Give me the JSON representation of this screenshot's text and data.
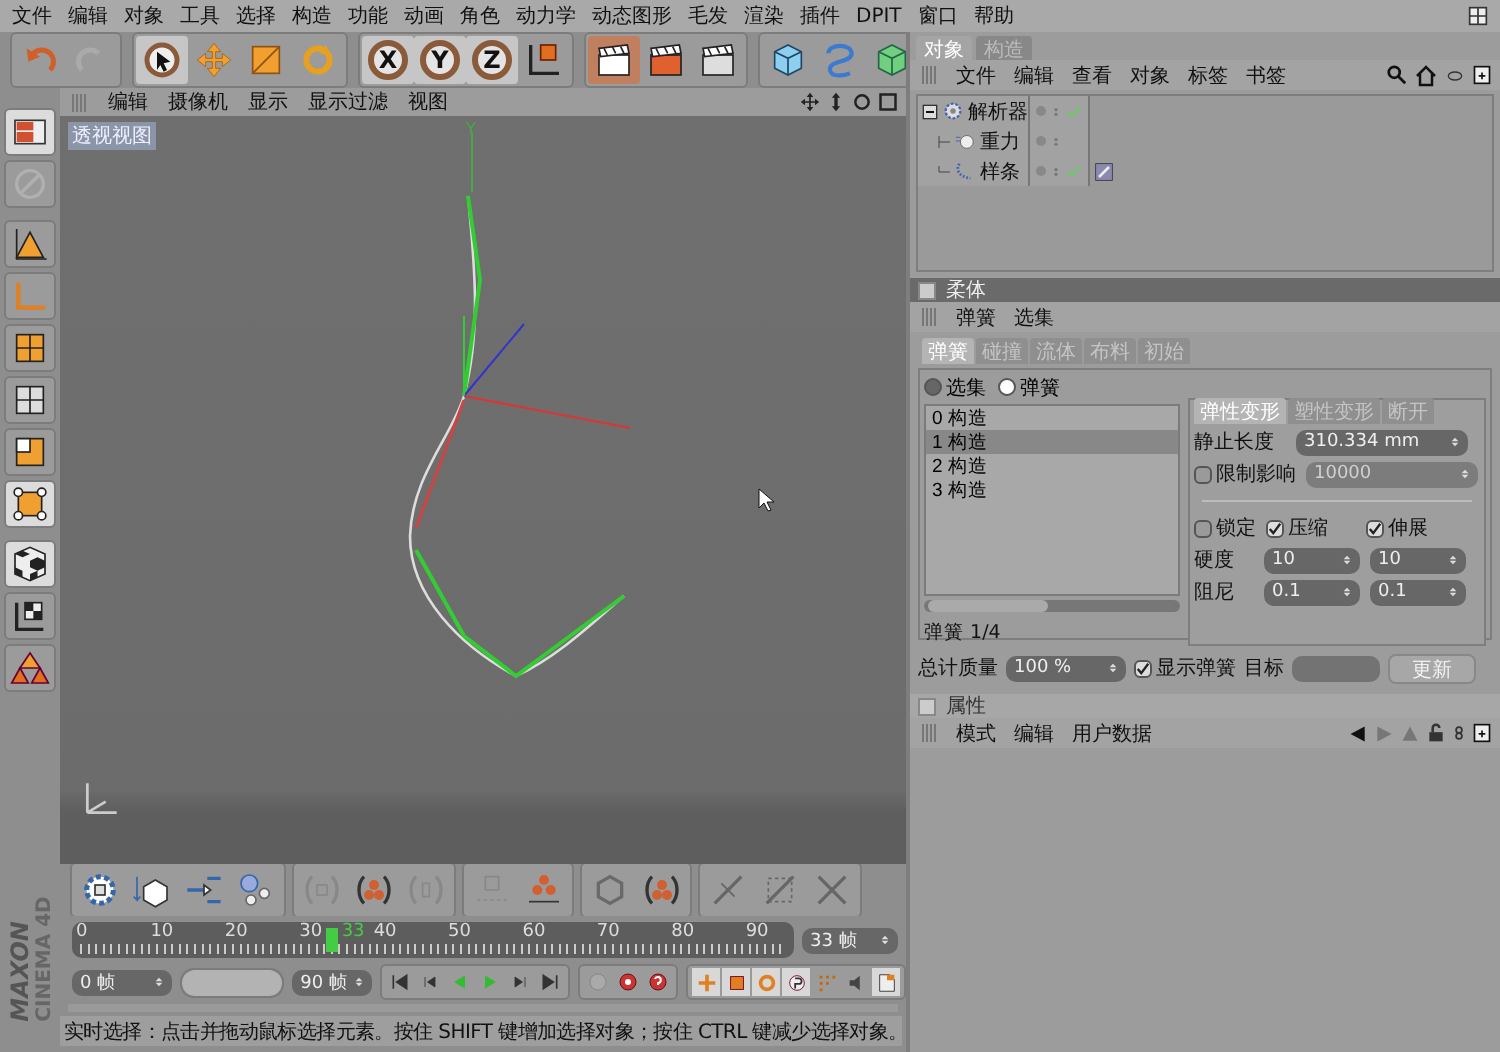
{
  "menu_bar": [
    "文件",
    "编辑",
    "对象",
    "工具",
    "选择",
    "构造",
    "功能",
    "动画",
    "角色",
    "动力学",
    "动态图形",
    "毛发",
    "渲染",
    "插件",
    "DPIT",
    "窗口",
    "帮助"
  ],
  "toolbar": [
    {
      "tools": [
        {
          "kind": "undo",
          "on": false
        },
        {
          "kind": "redo",
          "on": false
        }
      ]
    },
    {
      "tools": [
        {
          "kind": "select",
          "on": true
        },
        {
          "kind": "move",
          "on": false
        },
        {
          "kind": "scale",
          "on": false
        },
        {
          "kind": "rotate",
          "on": false
        }
      ]
    },
    {
      "tools": [
        {
          "kind": "axis",
          "label": "X",
          "on": true
        },
        {
          "kind": "axis",
          "label": "Y",
          "on": true
        },
        {
          "kind": "axis",
          "label": "Z",
          "on": true
        },
        {
          "kind": "coord",
          "on": false
        }
      ]
    },
    {
      "tools": [
        {
          "kind": "render_view",
          "on": true
        },
        {
          "kind": "render",
          "on": false
        },
        {
          "kind": "render_settings",
          "on": false
        }
      ]
    },
    {
      "tools": [
        {
          "kind": "cube",
          "on": false
        },
        {
          "kind": "spline",
          "on": false
        },
        {
          "kind": "nurbs",
          "on": false
        }
      ]
    }
  ],
  "left_tools": [
    {
      "kind": "layout",
      "on": true
    },
    {
      "kind": "faded",
      "on": false
    },
    {
      "kind": "axis_move",
      "on": false
    },
    {
      "kind": "axis_corner",
      "on": false
    },
    {
      "kind": "cube_grid",
      "on": false
    },
    {
      "kind": "grid",
      "on": false
    },
    {
      "kind": "quad",
      "on": false
    },
    {
      "kind": "points",
      "on": true
    },
    {
      "kind": "checker",
      "on": true
    },
    {
      "kind": "texture_axis",
      "on": false
    },
    {
      "kind": "cones",
      "on": false
    }
  ],
  "viewport": {
    "menu": [
      "编辑",
      "摄像机",
      "显示",
      "显示过滤",
      "视图"
    ],
    "title": "透视视图",
    "axis_label": "Y"
  },
  "object_manager": {
    "tabs": [
      {
        "label": "对象",
        "selected": true
      },
      {
        "label": "构造",
        "selected": false
      }
    ],
    "menu": [
      "文件",
      "编辑",
      "查看",
      "对象",
      "标签",
      "书签"
    ],
    "objects": [
      {
        "name": "解析器",
        "kind": "solver",
        "expanded": true,
        "enabled": true,
        "tag": false,
        "children": [
          {
            "name": "重力",
            "kind": "gravity",
            "enabled": false,
            "tag": false
          },
          {
            "name": "样条",
            "kind": "spline",
            "enabled": true,
            "tag": true
          }
        ]
      }
    ]
  },
  "soft_body": {
    "title": "柔体",
    "menu": [
      "弹簧",
      "选集"
    ],
    "tabs": [
      {
        "label": "弹簧",
        "selected": true
      },
      {
        "label": "碰撞",
        "selected": false
      },
      {
        "label": "流体",
        "selected": false
      },
      {
        "label": "布料",
        "selected": false
      },
      {
        "label": "初始",
        "selected": false
      }
    ],
    "radios": [
      {
        "label": "选集",
        "selected": false
      },
      {
        "label": "弹簧",
        "selected": true
      }
    ],
    "list": [
      {
        "label": "0 构造",
        "selected": false
      },
      {
        "label": "1 构造",
        "selected": true
      },
      {
        "label": "2 构造",
        "selected": false
      },
      {
        "label": "3 构造",
        "selected": false
      }
    ],
    "list_footer": "弹簧 1/4",
    "subtabs": [
      {
        "label": "弹性变形",
        "selected": true
      },
      {
        "label": "塑性变形",
        "selected": false
      },
      {
        "label": "断开",
        "selected": false
      }
    ],
    "rest_length": {
      "label": "静止长度",
      "value": "310.334 mm"
    },
    "limit": {
      "label": "限制影响",
      "checked": false,
      "value": "10000",
      "disabled": true
    },
    "checks": [
      {
        "label": "锁定",
        "checked": false
      },
      {
        "label": "压缩",
        "checked": true
      },
      {
        "label": "伸展",
        "checked": true
      }
    ],
    "pairs": [
      {
        "label": "硬度",
        "values": [
          "10",
          "10"
        ]
      },
      {
        "label": "阻尼",
        "values": [
          "0.1",
          "0.1"
        ]
      }
    ],
    "mass": {
      "label": "总计质量",
      "value": "100 %"
    },
    "show_springs": {
      "label": "显示弹簧",
      "checked": true
    },
    "target": {
      "label": "目标"
    },
    "update_button": "更新"
  },
  "attributes": {
    "title": "属性",
    "menu": [
      "模式",
      "编辑",
      "用户数据"
    ]
  },
  "timeline": {
    "ruler_labels": [
      "0",
      "10",
      "20",
      "30",
      "40",
      "50",
      "60",
      "70",
      "80",
      "90"
    ],
    "playhead": {
      "label": "33",
      "level": 0.355
    },
    "current_frame": "33 帧",
    "range_slider": {
      "level": 1
    },
    "start_frame": "0 帧",
    "end_frame": "90 帧"
  },
  "logo": {
    "brand": "MAXON",
    "product": "CINEMA 4D"
  },
  "status_bar": "实时选择：点击并拖动鼠标选择元素。按住 SHIFT 键增加选择对象；按住 CTRL 键减少选择对象。"
}
